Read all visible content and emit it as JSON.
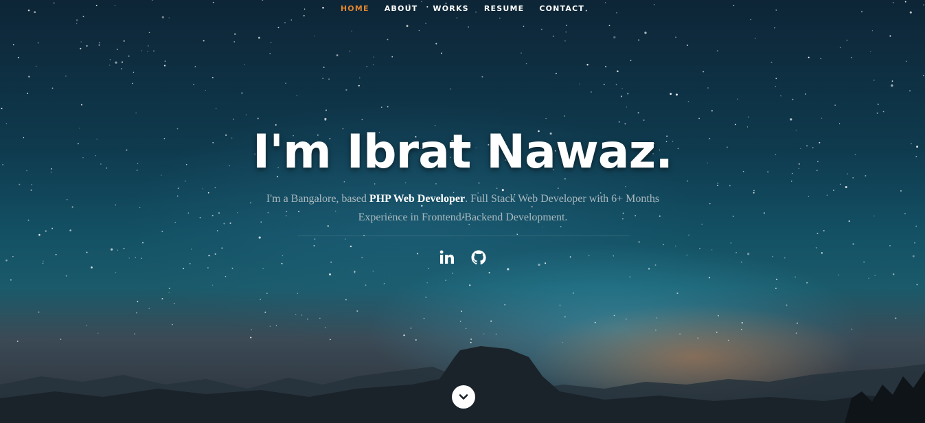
{
  "nav": {
    "items": [
      {
        "label": "HOME",
        "active": true
      },
      {
        "label": "ABOUT",
        "active": false
      },
      {
        "label": "WORKS",
        "active": false
      },
      {
        "label": "RESUME",
        "active": false
      },
      {
        "label": "CONTACT",
        "active": false
      }
    ],
    "active_color": "#e0852f"
  },
  "hero": {
    "headline": "I'm Ibrat Nawaz.",
    "intro_before": "I'm a Bangalore, based ",
    "intro_strong": "PHP Web Developer",
    "intro_after": ". Full Stack Web Developer with 6+ Months Experience in Frontend/Backend Development."
  },
  "social": {
    "icons": [
      "linkedin-icon",
      "github-icon"
    ]
  },
  "scroll": {
    "icon": "chevron-down-icon"
  }
}
